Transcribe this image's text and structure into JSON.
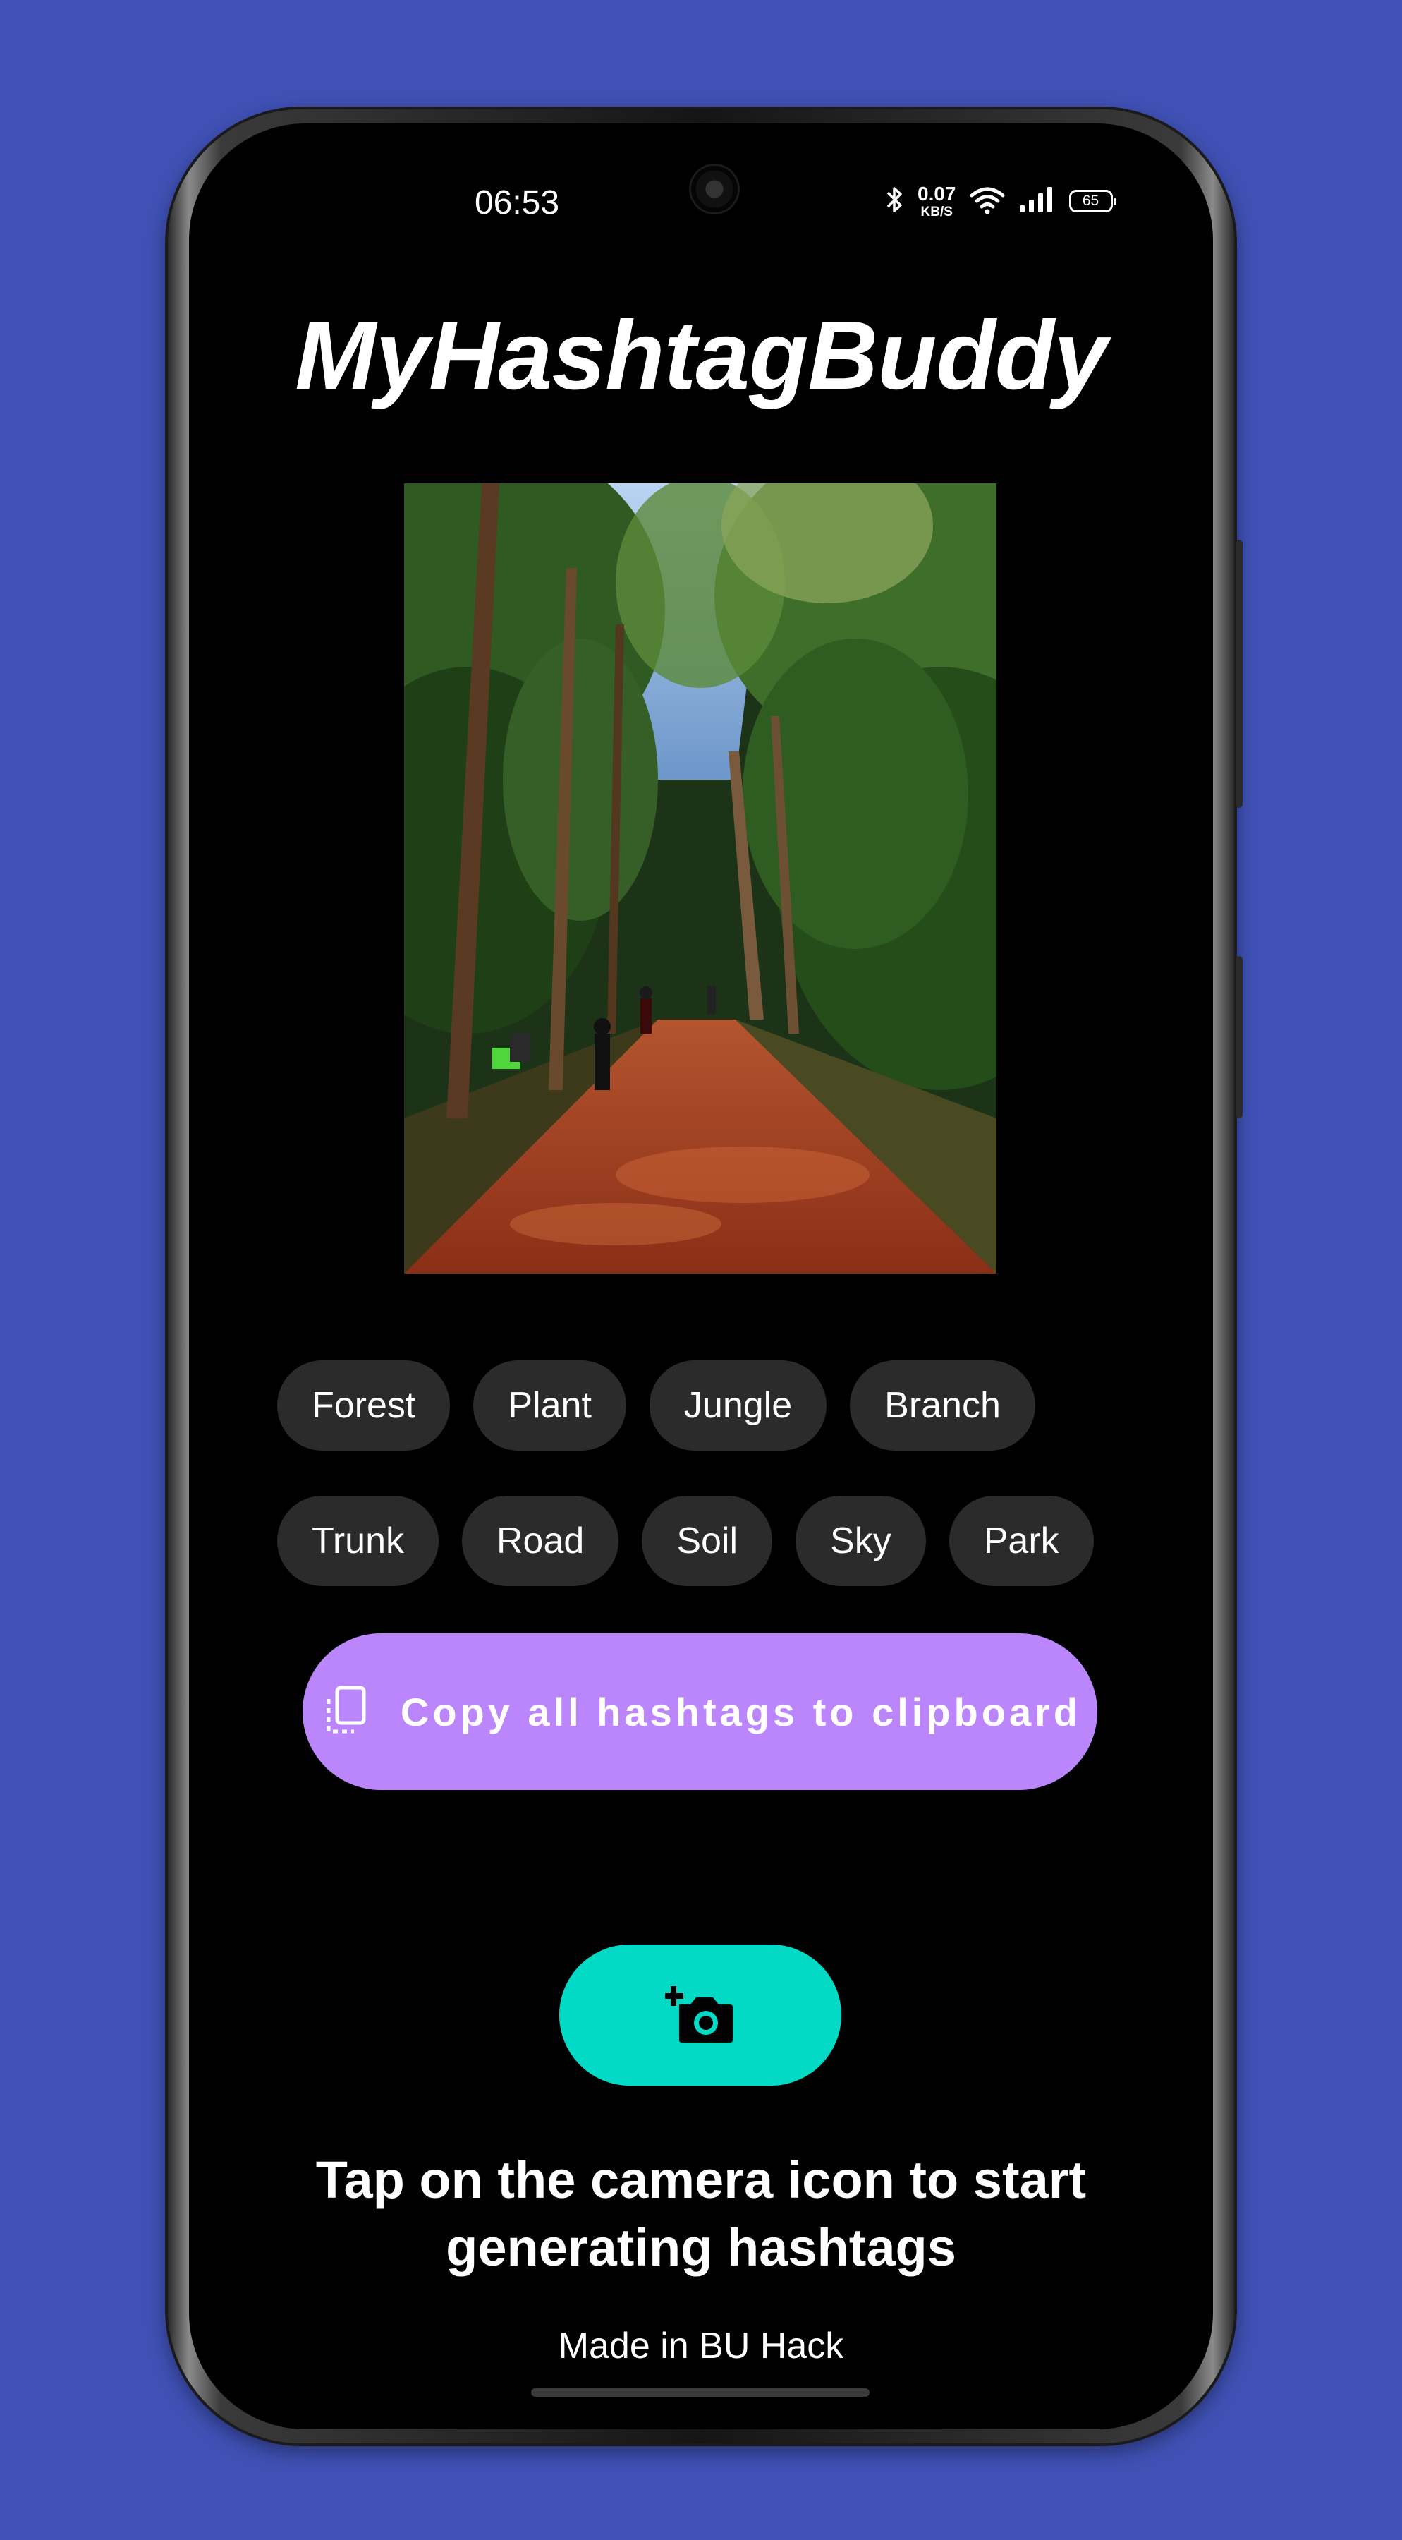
{
  "status_bar": {
    "time": "06:53",
    "net_speed_value": "0.07",
    "net_speed_unit": "KB/S",
    "battery": "65"
  },
  "app": {
    "title": "MyHashtagBuddy"
  },
  "photo": {
    "description_icon": "forest-photo"
  },
  "hashtags": {
    "row1": [
      "Forest",
      "Plant",
      "Jungle",
      "Branch"
    ],
    "row2": [
      "Trunk",
      "Road",
      "Soil",
      "Sky",
      "Park"
    ]
  },
  "copy_button": {
    "label": "Copy all hashtags to clipboard",
    "icon": "copy-icon",
    "color": "#bb86fc"
  },
  "camera_button": {
    "icon": "add-camera-icon",
    "color": "#03dac5"
  },
  "instruction": {
    "line1": "Tap on the camera icon to start",
    "line2": "generating hashtags"
  },
  "footer": {
    "text": "Made in BU Hack"
  },
  "colors": {
    "background": "#3f51b5",
    "screen": "#000000",
    "chip": "#2b2b2b"
  }
}
